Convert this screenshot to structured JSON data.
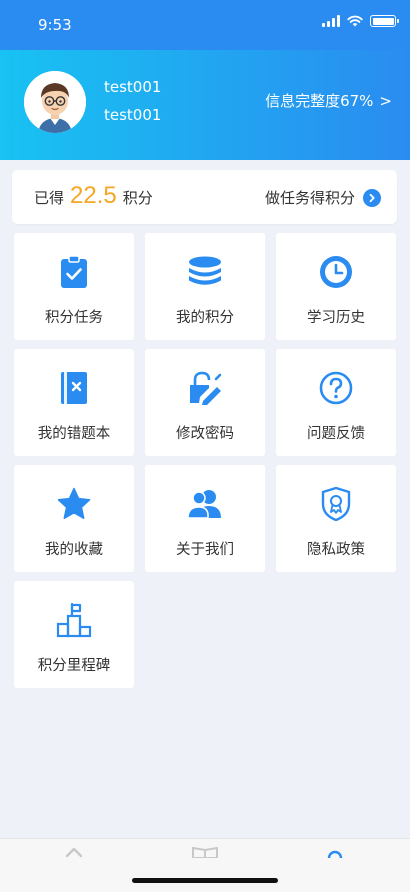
{
  "status": {
    "time": "9:53"
  },
  "profile": {
    "name": "test001",
    "account": "test001",
    "info_completion_text": "信息完整度67%",
    "chevron": ">"
  },
  "points": {
    "label_prefix": "已得",
    "value": "22.5",
    "label_suffix": "积分",
    "earn_link": "做任务得积分"
  },
  "menu": [
    {
      "label": "积分任务",
      "icon": "clipboard-check-icon"
    },
    {
      "label": "我的积分",
      "icon": "coin-stack-icon"
    },
    {
      "label": "学习历史",
      "icon": "clock-icon"
    },
    {
      "label": "我的错题本",
      "icon": "wrong-book-icon"
    },
    {
      "label": "修改密码",
      "icon": "lock-edit-icon"
    },
    {
      "label": "问题反馈",
      "icon": "question-icon"
    },
    {
      "label": "我的收藏",
      "icon": "star-icon"
    },
    {
      "label": "关于我们",
      "icon": "users-icon"
    },
    {
      "label": "隐私政策",
      "icon": "shield-badge-icon"
    },
    {
      "label": "积分里程碑",
      "icon": "milestone-icon"
    }
  ],
  "colors": {
    "brand": "#2a8cf0",
    "accent": "#f5a623",
    "gradient_start": "#18c2f2"
  }
}
